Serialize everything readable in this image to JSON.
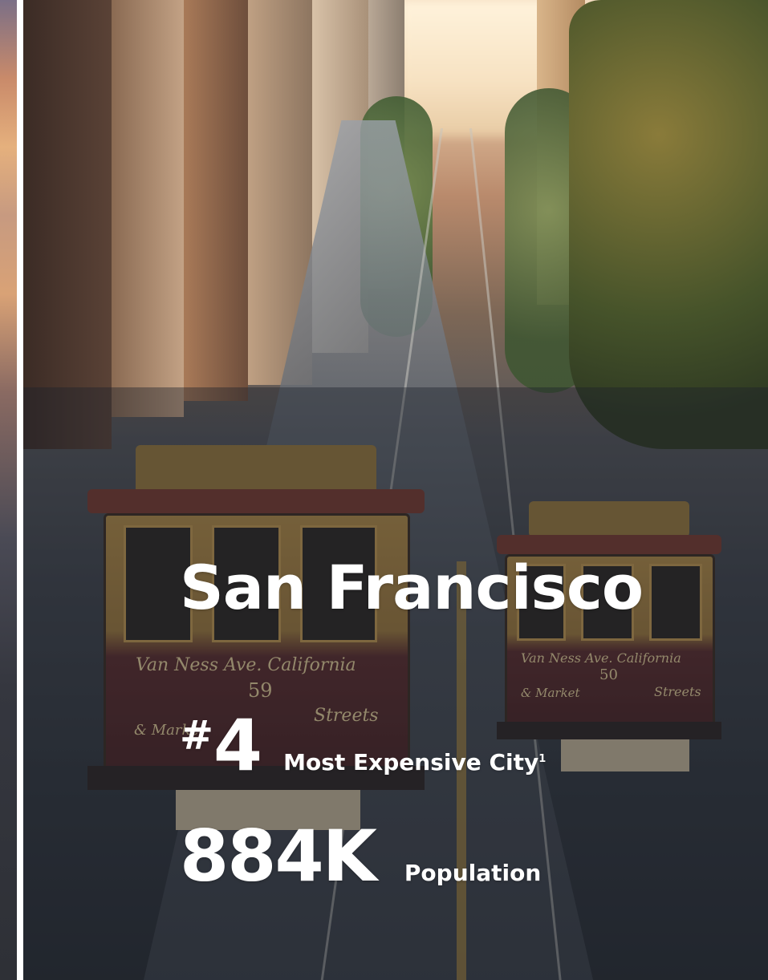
{
  "city": {
    "name": "San Francisco"
  },
  "stats": {
    "rank": {
      "prefix": "#",
      "value": "4",
      "label": "Most Expensive City",
      "footnote": "1"
    },
    "population": {
      "value": "884K",
      "label": "Population"
    }
  },
  "photo": {
    "car_left_banner_top": "Van Ness Ave. California",
    "car_left_number": "59",
    "car_left_banner_left": "& Market",
    "car_left_banner_right": "Streets",
    "car_right_banner_top": "Van Ness Ave. California",
    "car_right_number": "50",
    "car_right_banner_left": "& Market",
    "car_right_banner_right": "Streets"
  },
  "colors": {
    "divider": "#ffffff",
    "text": "#ffffff",
    "overlay": "rgba(28,34,44,0.42)"
  }
}
